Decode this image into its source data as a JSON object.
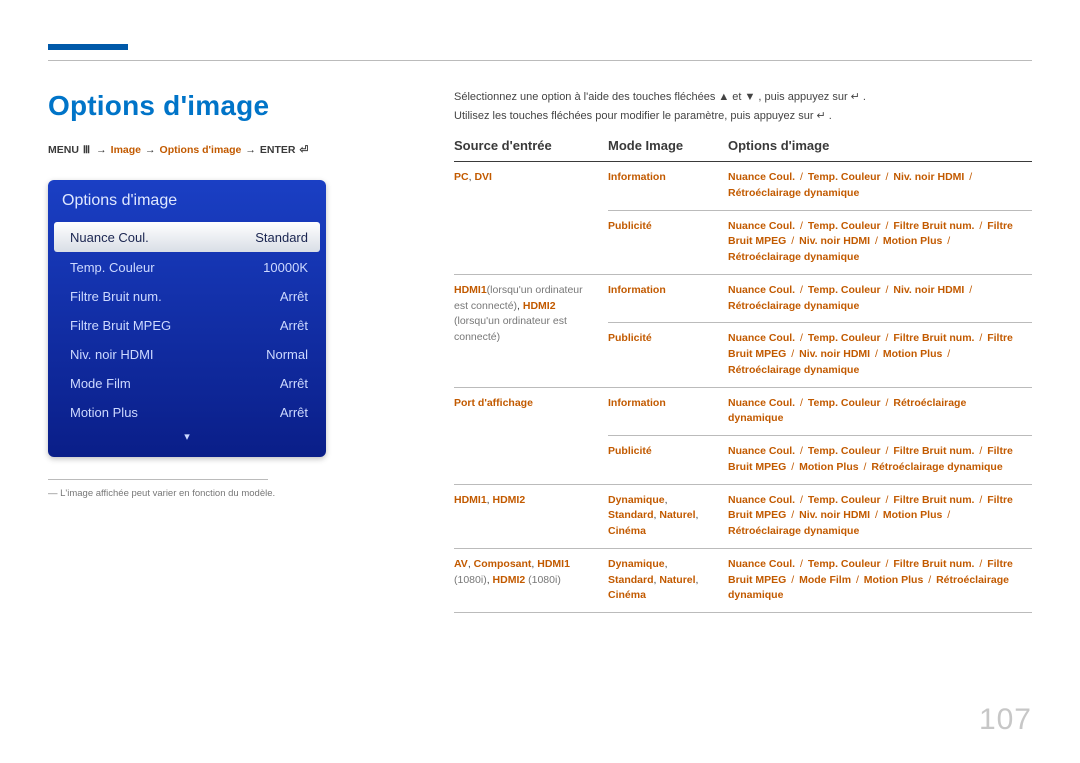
{
  "pageTitle": "Options d'image",
  "breadcrumb": {
    "menu": "MENU",
    "arrow": "→",
    "image": "Image",
    "options": "Options d'image",
    "enter": "ENTER"
  },
  "panel": {
    "header": "Options d'image",
    "rows": [
      {
        "label": "Nuance Coul.",
        "value": "Standard",
        "selected": true
      },
      {
        "label": "Temp. Couleur",
        "value": "10000K",
        "selected": false
      },
      {
        "label": "Filtre Bruit num.",
        "value": "Arrêt",
        "selected": false
      },
      {
        "label": "Filtre Bruit MPEG",
        "value": "Arrêt",
        "selected": false
      },
      {
        "label": "Niv. noir HDMI",
        "value": "Normal",
        "selected": false
      },
      {
        "label": "Mode Film",
        "value": "Arrêt",
        "selected": false
      },
      {
        "label": "Motion Plus",
        "value": "Arrêt",
        "selected": false
      }
    ]
  },
  "footnote": "― L'image affichée peut varier en fonction du modèle.",
  "instructions": [
    {
      "pre": "Sélectionnez une option à l'aide des touches fléchées ",
      "g1": "▲",
      "mid": " et ",
      "g2": "▼",
      "mid2": ", puis appuyez sur ",
      "g3": "↵",
      "post": "."
    },
    {
      "pre": "Utilisez les touches fléchées pour modifier le paramètre, puis appuyez sur ",
      "g1": "↵",
      "post": ".",
      "mid": "",
      "g2": "",
      "mid2": "",
      "g3": ""
    }
  ],
  "tableHeaders": {
    "source": "Source d'entrée",
    "mode": "Mode Image",
    "options": "Options d'image"
  },
  "rows": [
    {
      "source_html": "<span class='orange'>PC</span><span class='dark'>, </span><span class='orange'>DVI</span>",
      "sub": [
        {
          "mode_html": "<span class='orange'>Information</span>",
          "opt_html": "<span class='orange'>Nuance Coul.</span> <span class='slash'>/</span> <span class='orange'>Temp. Couleur</span> <span class='slash'>/</span> <span class='orange'>Niv. noir HDMI</span> <span class='slash'>/</span> <span class='orange'>Rétroéclairage dynamique</span>"
        },
        {
          "mode_html": "<span class='orange'>Publicité</span>",
          "opt_html": "<span class='orange'>Nuance Coul.</span> <span class='slash'>/</span> <span class='orange'>Temp. Couleur</span> <span class='slash'>/</span> <span class='orange'>Filtre Bruit num.</span> <span class='slash'>/</span> <span class='orange'>Filtre Bruit MPEG</span> <span class='slash'>/</span> <span class='orange'>Niv. noir HDMI</span> <span class='slash'>/</span> <span class='orange'>Motion Plus</span> <span class='slash'>/</span> <span class='orange'>Rétroéclairage dynamique</span>"
        }
      ]
    },
    {
      "source_html": "<span class='orange'>HDMI1</span><span class='gray'>(lorsqu'un ordinateur est connecté)</span><span class='dark'>, </span><span class='orange'>HDMI2</span> <span class='gray'>(lorsqu'un ordinateur est connecté)</span>",
      "sub": [
        {
          "mode_html": "<span class='orange'>Information</span>",
          "opt_html": "<span class='orange'>Nuance Coul.</span> <span class='slash'>/</span> <span class='orange'>Temp. Couleur</span> <span class='slash'>/</span> <span class='orange'>Niv. noir HDMI</span> <span class='slash'>/</span> <span class='orange'>Rétroéclairage dynamique</span>"
        },
        {
          "mode_html": "<span class='orange'>Publicité</span>",
          "opt_html": "<span class='orange'>Nuance Coul.</span> <span class='slash'>/</span> <span class='orange'>Temp. Couleur</span> <span class='slash'>/</span> <span class='orange'>Filtre Bruit num.</span> <span class='slash'>/</span> <span class='orange'>Filtre Bruit MPEG</span> <span class='slash'>/</span> <span class='orange'>Niv. noir HDMI</span> <span class='slash'>/</span> <span class='orange'>Motion Plus</span> <span class='slash'>/</span> <span class='orange'>Rétroéclairage dynamique</span>"
        }
      ]
    },
    {
      "source_html": "<span class='orange'>Port d'affichage</span>",
      "sub": [
        {
          "mode_html": "<span class='orange'>Information</span>",
          "opt_html": "<span class='orange'>Nuance Coul.</span> <span class='slash'>/</span> <span class='orange'>Temp. Couleur</span> <span class='slash'>/</span> <span class='orange'>Rétroéclairage dynamique</span>"
        },
        {
          "mode_html": "<span class='orange'>Publicité</span>",
          "opt_html": "<span class='orange'>Nuance Coul.</span> <span class='slash'>/</span> <span class='orange'>Temp. Couleur</span> <span class='slash'>/</span> <span class='orange'>Filtre Bruit num.</span> <span class='slash'>/</span> <span class='orange'>Filtre Bruit MPEG</span> <span class='slash'>/</span> <span class='orange'>Motion Plus</span> <span class='slash'>/</span> <span class='orange'>Rétroéclairage dynamique</span>"
        }
      ]
    },
    {
      "source_html": "<span class='orange'>HDMI1</span><span class='dark'>, </span><span class='orange'>HDMI2</span>",
      "sub": [
        {
          "mode_html": "<span class='orange'>Dynamique</span><span class='dark'>, </span><span class='orange'>Standard</span><span class='dark'>, </span><span class='orange'>Naturel</span><span class='dark'>, </span><span class='orange'>Cinéma</span>",
          "opt_html": "<span class='orange'>Nuance Coul.</span> <span class='slash'>/</span> <span class='orange'>Temp. Couleur</span> <span class='slash'>/</span> <span class='orange'>Filtre Bruit num.</span> <span class='slash'>/</span> <span class='orange'>Filtre Bruit MPEG</span> <span class='slash'>/</span> <span class='orange'>Niv. noir HDMI</span> <span class='slash'>/</span> <span class='orange'>Motion Plus</span> <span class='slash'>/</span> <span class='orange'>Rétroéclairage dynamique</span>"
        }
      ]
    },
    {
      "source_html": "<span class='orange'>AV</span><span class='dark'>, </span><span class='orange'>Composant</span><span class='dark'>, </span><span class='orange'>HDMI1</span> <span class='gray'>(1080i)</span><span class='dark'>, </span><span class='orange'>HDMI2</span> <span class='gray'>(1080i)</span>",
      "sub": [
        {
          "mode_html": "<span class='orange'>Dynamique</span><span class='dark'>, </span><span class='orange'>Standard</span><span class='dark'>, </span><span class='orange'>Naturel</span><span class='dark'>, </span><span class='orange'>Cinéma</span>",
          "opt_html": "<span class='orange'>Nuance Coul.</span> <span class='slash'>/</span> <span class='orange'>Temp. Couleur</span> <span class='slash'>/</span> <span class='orange'>Filtre Bruit num.</span> <span class='slash'>/</span> <span class='orange'>Filtre Bruit MPEG</span> <span class='slash'>/</span> <span class='orange'>Mode Film</span> <span class='slash'>/</span> <span class='orange'>Motion Plus</span> <span class='slash'>/</span> <span class='orange'>Rétroéclairage dynamique</span>"
        }
      ]
    }
  ],
  "pageNumber": "107"
}
